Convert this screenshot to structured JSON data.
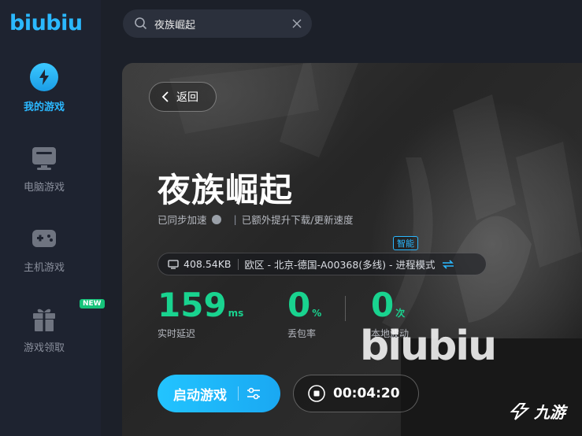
{
  "app": {
    "logo": "biubiu"
  },
  "sidebar": {
    "items": [
      {
        "label": "我的游戏",
        "icon": "lightning-icon",
        "active": true
      },
      {
        "label": "电脑游戏",
        "icon": "monitor-icon",
        "active": false
      },
      {
        "label": "主机游戏",
        "icon": "gamepad-icon",
        "active": false
      },
      {
        "label": "游戏领取",
        "icon": "gift-icon",
        "active": false,
        "badge": "NEW"
      }
    ]
  },
  "search": {
    "value": "夜族崛起"
  },
  "detail": {
    "back_label": "返回",
    "title": "夜族崛起",
    "sync_text": "已同步加速",
    "extra_text": "已额外提升下载/更新速度",
    "smart_tag": "智能",
    "route": {
      "download_size": "408.54KB",
      "route_text": "欧区 - 北京-德国-A00368(多线) - 进程模式"
    },
    "stats": {
      "latency": {
        "value": "159",
        "unit": "ms",
        "label": "实时延迟"
      },
      "packet_loss": {
        "value": "0",
        "unit": "%",
        "label": "丢包率"
      },
      "local": {
        "value": "0",
        "unit": "次",
        "label": "本地波动"
      }
    },
    "launch_label": "启动游戏",
    "timer": "00:04:20"
  },
  "watermark": {
    "text": "biubiu",
    "corner_text": "九游"
  },
  "colors": {
    "accent": "#2bb8ff",
    "stat_green": "#19d38f",
    "sidebar_bg": "#1e2330"
  }
}
